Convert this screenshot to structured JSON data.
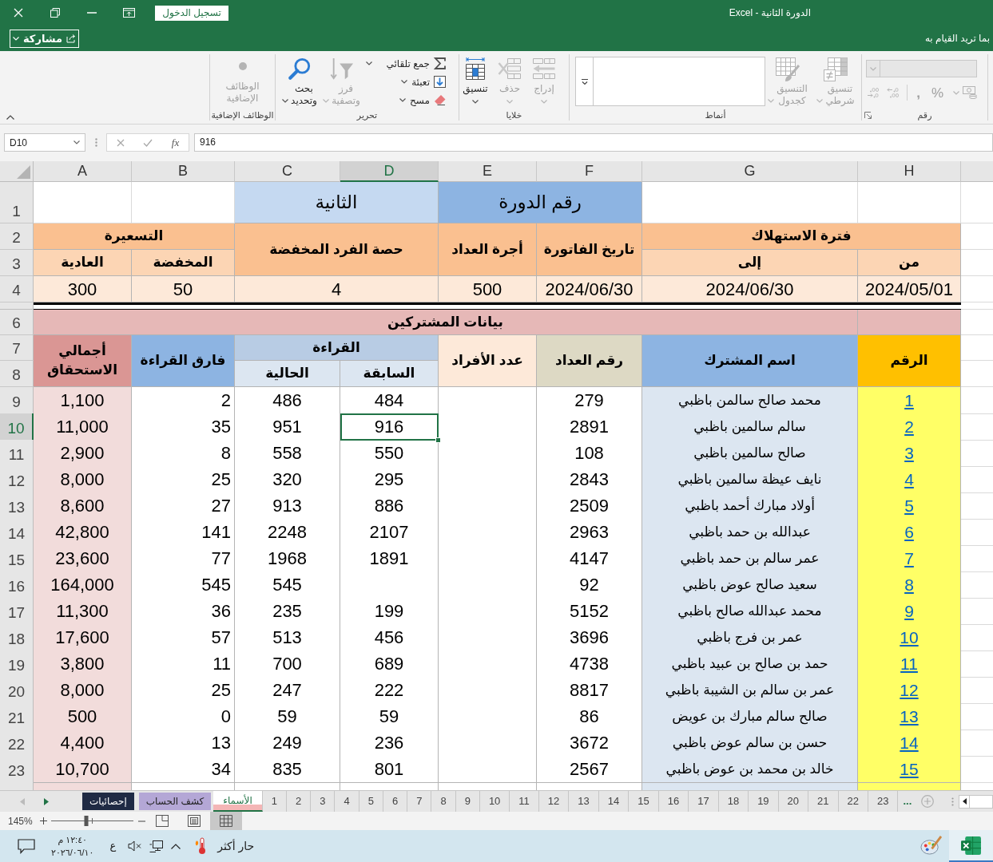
{
  "window": {
    "title": "الدورة الثانية - Excel",
    "sign_in": "تسجيل الدخول",
    "share": "مشاركة",
    "tell_me": "بما تريد القيام به"
  },
  "ribbon": {
    "groups": [
      {
        "kind": "number",
        "label": "رقم",
        "items": [
          {
            "kind": "format-box",
            "disabled": true
          },
          {
            "kind": "accounting",
            "disabled": true
          },
          {
            "kind": "percent",
            "text": "%",
            "disabled": true
          },
          {
            "kind": "comma",
            "text": ",",
            "disabled": true
          },
          {
            "kind": "decimal-increase",
            "disabled": true
          },
          {
            "kind": "decimal-decrease",
            "disabled": true
          }
        ]
      },
      {
        "kind": "styles",
        "label": "أنماط",
        "items": [
          {
            "kind": "conditional-format",
            "label": "تنسيق شرطي",
            "disabled": true
          },
          {
            "kind": "table-format",
            "label": "التنسيق كجدول",
            "disabled": true
          },
          {
            "kind": "gallery"
          }
        ]
      },
      {
        "kind": "cells",
        "label": "خلايا",
        "items": [
          {
            "kind": "insert",
            "label": "إدراج",
            "disabled": true
          },
          {
            "kind": "delete",
            "label": "حذف",
            "disabled": true
          },
          {
            "kind": "format",
            "label": "تنسيق",
            "disabled": false
          }
        ]
      },
      {
        "kind": "editing",
        "label": "تحرير",
        "items": [
          {
            "kind": "autosum",
            "label": "جمع تلقائي",
            "disabled": false
          },
          {
            "kind": "fill",
            "label": "تعبئة",
            "disabled": false
          },
          {
            "kind": "clear",
            "label": "مسح",
            "disabled": false
          },
          {
            "kind": "sort-filter",
            "label": "فرز وتصفية",
            "disabled": true
          },
          {
            "kind": "find-select",
            "label": "بحث وتحديد",
            "disabled": false
          }
        ]
      },
      {
        "kind": "addins",
        "label": "الوظائف الإضافية",
        "items": [
          {
            "kind": "addins",
            "label": "الوظائف الإضافية",
            "disabled": true
          }
        ]
      }
    ]
  },
  "formula_bar": {
    "name_box": "D10",
    "function_button": "fx",
    "formula": "916"
  },
  "sheet": {
    "columns": [
      {
        "label": "H",
        "selected": false
      },
      {
        "label": "G",
        "selected": false
      },
      {
        "label": "F",
        "selected": false
      },
      {
        "label": "E",
        "selected": false
      },
      {
        "label": "D",
        "selected": true
      },
      {
        "label": "C",
        "selected": false
      },
      {
        "label": "B",
        "selected": false
      },
      {
        "label": "A",
        "selected": false
      }
    ],
    "rows": [
      {
        "label": "1",
        "selected": false
      },
      {
        "label": "2",
        "selected": false
      },
      {
        "label": "3",
        "selected": false
      },
      {
        "label": "4",
        "selected": false
      },
      {
        "label": "6",
        "selected": false
      },
      {
        "label": "7",
        "selected": false
      },
      {
        "label": "8",
        "selected": false
      },
      {
        "label": "9",
        "selected": false
      },
      {
        "label": "10",
        "selected": true
      },
      {
        "label": "11",
        "selected": false
      },
      {
        "label": "12",
        "selected": false
      },
      {
        "label": "13",
        "selected": false
      },
      {
        "label": "14",
        "selected": false
      },
      {
        "label": "15",
        "selected": false
      },
      {
        "label": "16",
        "selected": false
      },
      {
        "label": "17",
        "selected": false
      },
      {
        "label": "18",
        "selected": false
      },
      {
        "label": "19",
        "selected": false
      },
      {
        "label": "20",
        "selected": false
      },
      {
        "label": "21",
        "selected": false
      },
      {
        "label": "22",
        "selected": false
      },
      {
        "label": "23",
        "selected": false
      }
    ]
  },
  "summary": {
    "course_label": "رقم الدورة",
    "course_value": "الثانية",
    "period": {
      "label": "فترة الاستهلاك",
      "from_label": "من",
      "to_label": "إلى",
      "from": "2024/05/01",
      "to": "2024/06/30"
    },
    "invoice_date": {
      "label": "تاريخ الفاتورة",
      "value": "2024/06/30"
    },
    "meter_fee": {
      "label": "أجرة العداد",
      "value": "500"
    },
    "reduced_share": {
      "label": "حصة الفرد المخفضة",
      "value": "4"
    },
    "pricing": {
      "label": "التسعيرة",
      "reduced_label": "المخفضة",
      "normal_label": "العادية",
      "reduced": "50",
      "normal": "300"
    }
  },
  "subscribers": {
    "title": "بيانات المشتركين",
    "headers": {
      "number": "الرقم",
      "name": "اسم المشترك",
      "meter": "رقم العداد",
      "members": "عدد الأفراد",
      "reading": "القراءة",
      "previous": "السابقة",
      "current": "الحالية",
      "difference": "فارق القراءة",
      "total": "أجمالي الاستحقاق"
    },
    "rows": [
      {
        "number": "1",
        "name": "محمد صالح سالمن باظبي",
        "meter": "279",
        "previous": "484",
        "current": "486",
        "difference": "2",
        "total": "1,100"
      },
      {
        "number": "2",
        "name": "سالم سالمين باظبي",
        "meter": "2891",
        "previous": "916",
        "current": "951",
        "difference": "35",
        "total": "11,000"
      },
      {
        "number": "3",
        "name": "صالح سالمين باظبي",
        "meter": "108",
        "previous": "550",
        "current": "558",
        "difference": "8",
        "total": "2,900"
      },
      {
        "number": "4",
        "name": "نايف عيظة سالمين باظبي",
        "meter": "2843",
        "previous": "295",
        "current": "320",
        "difference": "25",
        "total": "8,000"
      },
      {
        "number": "5",
        "name": "أولاد مبارك أحمد باظبي",
        "meter": "2509",
        "previous": "886",
        "current": "913",
        "difference": "27",
        "total": "8,600"
      },
      {
        "number": "6",
        "name": "عبدالله بن حمد باظبي",
        "meter": "2963",
        "previous": "2107",
        "current": "2248",
        "difference": "141",
        "total": "42,800"
      },
      {
        "number": "7",
        "name": "عمر سالم بن حمد باظبي",
        "meter": "4147",
        "previous": "1891",
        "current": "1968",
        "difference": "77",
        "total": "23,600"
      },
      {
        "number": "8",
        "name": "سعيد صالح عوض باظبي",
        "meter": "92",
        "current": "545",
        "difference": "545",
        "total": "164,000"
      },
      {
        "number": "9",
        "name": "محمد عبدالله صالح باظبي",
        "meter": "5152",
        "previous": "199",
        "current": "235",
        "difference": "36",
        "total": "11,300"
      },
      {
        "number": "10",
        "name": "عمر بن فرج باظبي",
        "meter": "3696",
        "previous": "456",
        "current": "513",
        "difference": "57",
        "total": "17,600"
      },
      {
        "number": "11",
        "name": "حمد بن صالح بن عبيد باظبي",
        "meter": "4738",
        "previous": "689",
        "current": "700",
        "difference": "11",
        "total": "3,800"
      },
      {
        "number": "12",
        "name": "عمر بن سالم بن الشيبة باظبي",
        "meter": "8817",
        "previous": "222",
        "current": "247",
        "difference": "25",
        "total": "8,000"
      },
      {
        "number": "13",
        "name": "صالح سالم مبارك بن عويض",
        "meter": "86",
        "previous": "59",
        "current": "59",
        "difference": "0",
        "total": "500"
      },
      {
        "number": "14",
        "name": "حسن بن سالم عوض باظبي",
        "meter": "3672",
        "previous": "236",
        "current": "249",
        "difference": "13",
        "total": "4,400"
      },
      {
        "number": "15",
        "name": "خالد بن محمد بن عوض باظبي",
        "meter": "2567",
        "previous": "801",
        "current": "835",
        "difference": "34",
        "total": "10,700"
      }
    ]
  },
  "sheet_tabs": {
    "tabs": [
      {
        "label": "23",
        "selected": false
      },
      {
        "label": "22",
        "selected": false
      },
      {
        "label": "21",
        "selected": false
      },
      {
        "label": "20",
        "selected": false
      },
      {
        "label": "19",
        "selected": false
      },
      {
        "label": "18",
        "selected": false
      },
      {
        "label": "17",
        "selected": false
      },
      {
        "label": "16",
        "selected": false
      },
      {
        "label": "15",
        "selected": false
      },
      {
        "label": "14",
        "selected": false
      },
      {
        "label": "13",
        "selected": false
      },
      {
        "label": "12",
        "selected": false
      },
      {
        "label": "11",
        "selected": false
      },
      {
        "label": "10",
        "selected": false
      },
      {
        "label": "9",
        "selected": false
      },
      {
        "label": "8",
        "selected": false
      },
      {
        "label": "7",
        "selected": false
      },
      {
        "label": "6",
        "selected": false
      },
      {
        "label": "5",
        "selected": false
      },
      {
        "label": "4",
        "selected": false
      },
      {
        "label": "3",
        "selected": false
      },
      {
        "label": "2",
        "selected": false
      },
      {
        "label": "1",
        "selected": false
      },
      {
        "label": "الأسماء",
        "selected": true,
        "color": "#f4b6b6"
      },
      {
        "label": "كشف الحساب",
        "selected": false,
        "color": "#b4a7d6"
      },
      {
        "label": "إحصائيات",
        "selected": false,
        "color": "#1f2a44"
      }
    ],
    "more": "..."
  },
  "status_bar": {
    "zoom": "145%",
    "zoom_slider": {
      "level": 0.43
    },
    "views": [
      {
        "kind": "page-break",
        "selected": false
      },
      {
        "kind": "page-layout",
        "selected": false
      },
      {
        "kind": "normal",
        "selected": true
      }
    ]
  },
  "taskbar": {
    "time": "١٢:٤٠ م",
    "date": "٢٠٢٦/٠٦/١٠",
    "language": "ع",
    "weather": "حار أكثر",
    "apps": [
      {
        "kind": "paint",
        "selected": false
      },
      {
        "kind": "excel",
        "selected": true
      }
    ]
  }
}
